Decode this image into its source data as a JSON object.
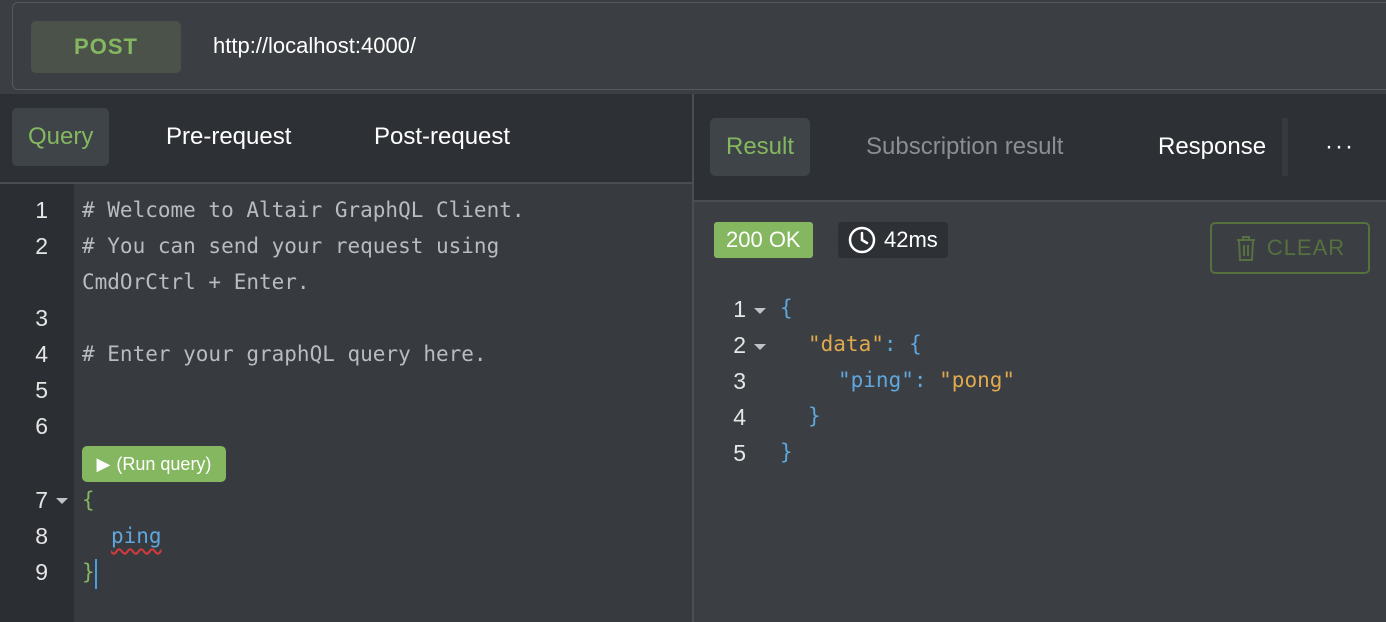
{
  "request": {
    "method": "POST",
    "url": "http://localhost:4000/"
  },
  "editor_tabs": [
    "Query",
    "Pre-request",
    "Post-request"
  ],
  "editor": {
    "line_numbers": [
      "1",
      "2",
      "3",
      "4",
      "5",
      "6",
      "7",
      "8",
      "9"
    ],
    "lines": {
      "l1": "# Welcome to Altair GraphQL Client.",
      "l2a": "# You can send your request using",
      "l2b": "CmdOrCtrl + Enter.",
      "l3": "",
      "l4": "# Enter your graphQL query here.",
      "l7": "{",
      "l8": "ping",
      "l9": "}"
    },
    "run_query_label": "(Run query)",
    "run_query_icon": "play-icon"
  },
  "result_tabs": {
    "result": "Result",
    "subscription": "Subscription result",
    "response": "Response",
    "more": "···"
  },
  "result_meta": {
    "status": "200 OK",
    "time": "42ms",
    "clear_label": "CLEAR"
  },
  "result_json": {
    "line_numbers": [
      "1",
      "2",
      "3",
      "4",
      "5"
    ],
    "open_brace": "{",
    "data_key": "\"data\"",
    "colon": ": ",
    "data_open": "{",
    "ping_key": "\"ping\"",
    "ping_value": "\"pong\"",
    "inner_close": "}",
    "outer_close": "}"
  },
  "colors": {
    "accent_green": "#84b75f",
    "json_key": "#e0a94f",
    "json_brace": "#5fa8dd"
  }
}
